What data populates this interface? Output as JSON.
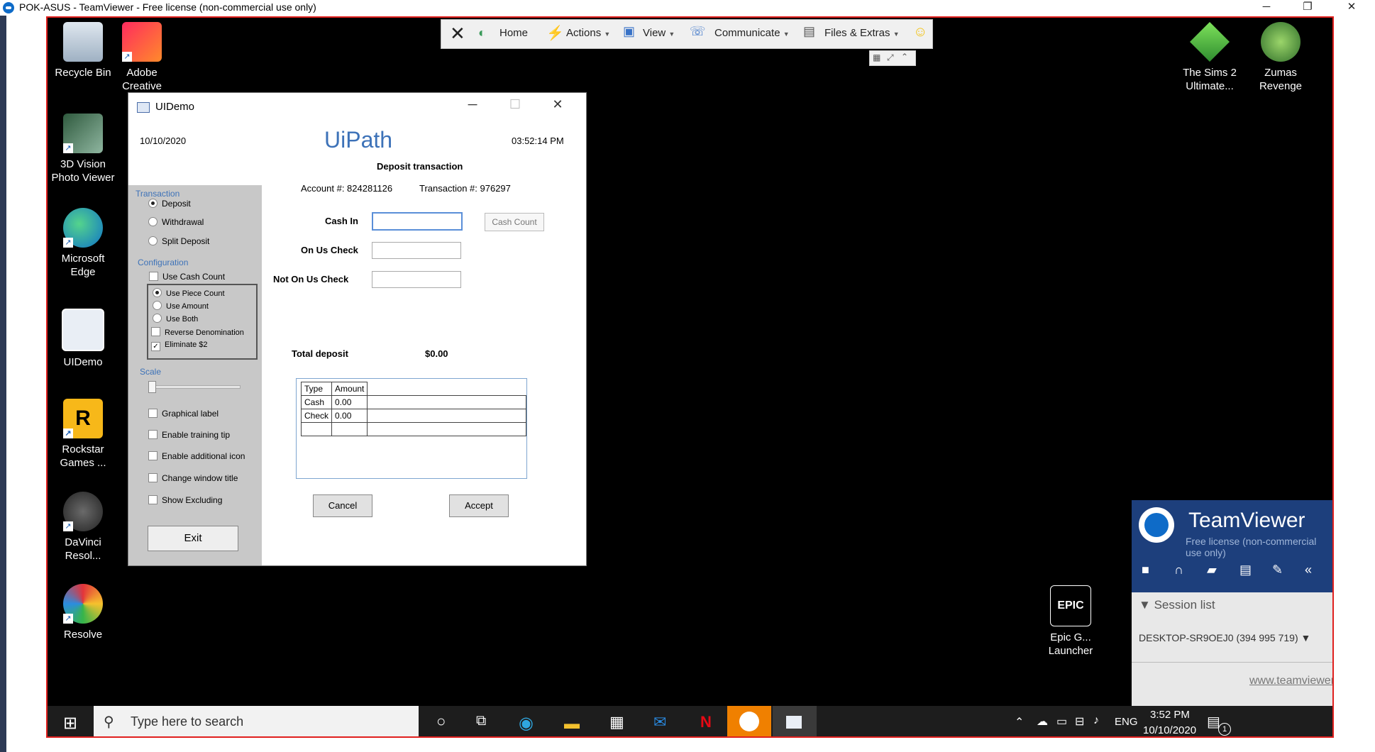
{
  "window": {
    "title": "POK-ASUS - TeamViewer - Free license (non-commercial use only)",
    "minimize": "─",
    "restore": "❐",
    "close": "✕"
  },
  "desktop_icons": [
    {
      "label": "Recycle Bin",
      "icon": "recycle-bin-icon"
    },
    {
      "label": "Adobe Creative",
      "icon": "adobe-cc-icon"
    },
    {
      "label": "3D Vision Photo Viewer",
      "icon": "3d-vision-icon"
    },
    {
      "label": "Microsoft Edge",
      "icon": "edge-icon"
    },
    {
      "label": "UIDemo",
      "icon": "uidemo-icon"
    },
    {
      "label": "Rockstar Games ...",
      "icon": "rockstar-icon"
    },
    {
      "label": "DaVinci Resol...",
      "icon": "davinci-icon"
    },
    {
      "label": "Resolve",
      "icon": "resolve-icon"
    },
    {
      "label": "The Sims 2 Ultimate...",
      "icon": "sims-icon"
    },
    {
      "label": "Zumas Revenge",
      "icon": "zuma-icon"
    },
    {
      "label": "Epic G... Launcher",
      "icon": "epic-icon"
    }
  ],
  "toolbar": {
    "home": "Home",
    "actions": "Actions",
    "view": "View",
    "communicate": "Communicate",
    "files": "Files & Extras"
  },
  "uidemo": {
    "title": "UIDemo",
    "date": "10/10/2020",
    "brand": "UiPath",
    "time": "03:52:14 PM",
    "transaction_header": "Transaction",
    "radios": [
      "Deposit",
      "Withdrawal",
      "Split Deposit"
    ],
    "configuration_header": "Configuration",
    "use_cash_count": "Use Cash Count",
    "config_radios": [
      "Use Piece Count",
      "Use Amount",
      "Use Both"
    ],
    "reverse_denomination": "Reverse Denomination",
    "eliminate": "Eliminate $2",
    "scale": "Scale",
    "checks": [
      "Graphical label",
      "Enable training tip",
      "Enable additional icon",
      "Change window title",
      "Show Excluding"
    ],
    "exit": "Exit",
    "heading": "Deposit transaction",
    "account": "Account #: 824281126",
    "transaction": "Transaction #: 976297",
    "cash_in": "Cash In",
    "cash_count_btn": "Cash Count",
    "on_us_check": "On Us Check",
    "not_on_us_check": "Not On Us Check",
    "total_label": "Total deposit",
    "total_value": "$0.00",
    "grid_headers": [
      "Type",
      "Amount"
    ],
    "grid_rows": [
      [
        "Cash",
        "0.00"
      ],
      [
        "Check",
        "0.00"
      ]
    ],
    "cancel": "Cancel",
    "accept": "Accept"
  },
  "tvpanel": {
    "brand": "TeamViewer",
    "license": "Free license (non-commercial use only)",
    "session_list": "Session list",
    "session": "DESKTOP-SR9OEJ0 (394 995 719)",
    "link": "www.teamviewer.com"
  },
  "taskbar": {
    "search_placeholder": "Type here to search",
    "lang": "ENG",
    "time": "3:52 PM",
    "date": "10/10/2020",
    "notif": "1"
  }
}
